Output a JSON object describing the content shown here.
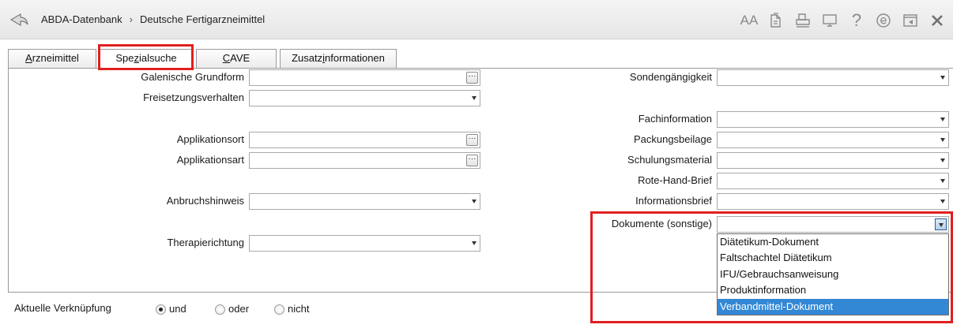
{
  "breadcrumb": {
    "root": "ABDA-Datenbank",
    "separator": "›",
    "current": "Deutsche Fertigarzneimittel"
  },
  "toolbar": {
    "text_size_icon": "AA",
    "help_icon": "?",
    "icons": [
      "text-size-icon",
      "document-icon",
      "print-icon",
      "monitor-icon",
      "help-icon",
      "e-icon",
      "window-icon",
      "close-icon"
    ]
  },
  "tabs": [
    {
      "pre": "",
      "key": "A",
      "post": "rzneimittel"
    },
    {
      "pre": "Spe",
      "key": "z",
      "post": "ialsuche"
    },
    {
      "pre": "",
      "key": "C",
      "post": "AVE"
    },
    {
      "pre": "Zusatz",
      "key": "i",
      "post": "nformationen"
    }
  ],
  "left_fields": {
    "galenische_grundform": "Galenische Grundform",
    "freisetzungsverhalten": "Freisetzungsverhalten",
    "applikationsort": "Applikationsort",
    "applikationsart": "Applikationsart",
    "anbruchshinweis": "Anbruchshinweis",
    "therapierichtung": "Therapierichtung"
  },
  "right_fields": {
    "sondengaengigkeit": "Sondengängigkeit",
    "fachinformation": "Fachinformation",
    "packungsbeilage": "Packungsbeilage",
    "schulungsmaterial": "Schulungsmaterial",
    "rote_hand_brief": "Rote-Hand-Brief",
    "informationsbrief": "Informationsbrief",
    "dokumente_sonstige": "Dokumente (sonstige)"
  },
  "dropdown_options": [
    "Diätetikum-Dokument",
    "Faltschachtel Diätetikum",
    "IFU/Gebrauchsanweisung",
    "Produktinformation",
    "Verbandmittel-Dokument"
  ],
  "dropdown_selected_index": 4,
  "linkage": {
    "label": "Aktuelle Verknüpfung",
    "options": [
      "und",
      "oder",
      "nicht"
    ],
    "selected": "und"
  },
  "colors": {
    "highlight": "#e02020",
    "selection": "#3388d6"
  }
}
